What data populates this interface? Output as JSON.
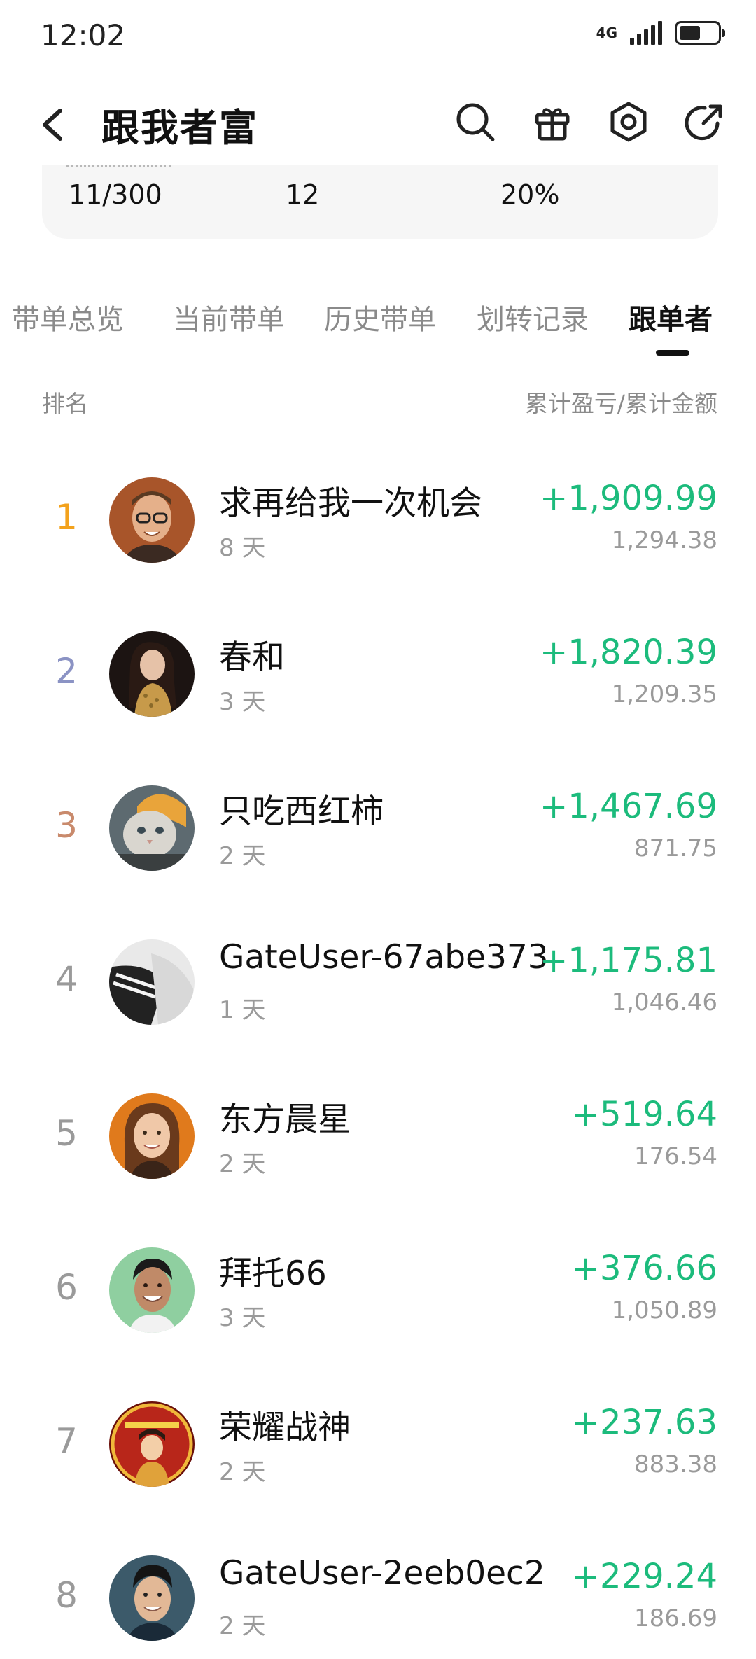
{
  "status_bar": {
    "time": "12:02",
    "network": "4G",
    "battery_level": 0.55
  },
  "header": {
    "title": "跟我者富",
    "icons": [
      "back-icon",
      "search-icon",
      "gift-icon",
      "settings-hexagon-icon",
      "share-icon"
    ]
  },
  "summary": {
    "followers": "11/300",
    "count": "12",
    "ratio": "20%"
  },
  "tabs": {
    "items": [
      {
        "label": "带单总览"
      },
      {
        "label": "当前带单"
      },
      {
        "label": "历史带单"
      },
      {
        "label": "划转记录"
      },
      {
        "label": "跟单者"
      }
    ],
    "active_index": 4
  },
  "list_header": {
    "left": "排名",
    "right": "累计盈亏/累计金额"
  },
  "colors": {
    "profit": "#1cbb7c",
    "rank_gold": "#f3a21c",
    "rank_silver": "#8b93c4",
    "rank_bronze": "#c98a6c",
    "rank_default": "#9a9a9a"
  },
  "followers": [
    {
      "rank": "1",
      "name": "求再给我一次机会",
      "days": "8 天",
      "pnl": "+1,909.99",
      "amount": "1,294.38"
    },
    {
      "rank": "2",
      "name": "春和",
      "days": "3 天",
      "pnl": "+1,820.39",
      "amount": "1,209.35"
    },
    {
      "rank": "3",
      "name": "只吃西红柿",
      "days": "2 天",
      "pnl": "+1,467.69",
      "amount": "871.75"
    },
    {
      "rank": "4",
      "name": "GateUser-67abe373",
      "days": "1 天",
      "pnl": "+1,175.81",
      "amount": "1,046.46"
    },
    {
      "rank": "5",
      "name": "东方晨星",
      "days": "2 天",
      "pnl": "+519.64",
      "amount": "176.54"
    },
    {
      "rank": "6",
      "name": "拜托66",
      "days": "3 天",
      "pnl": "+376.66",
      "amount": "1,050.89"
    },
    {
      "rank": "7",
      "name": "荣耀战神",
      "days": "2 天",
      "pnl": "+237.63",
      "amount": "883.38"
    },
    {
      "rank": "8",
      "name": "GateUser-2eeb0ec2",
      "days": "2 天",
      "pnl": "+229.24",
      "amount": "186.69"
    }
  ]
}
